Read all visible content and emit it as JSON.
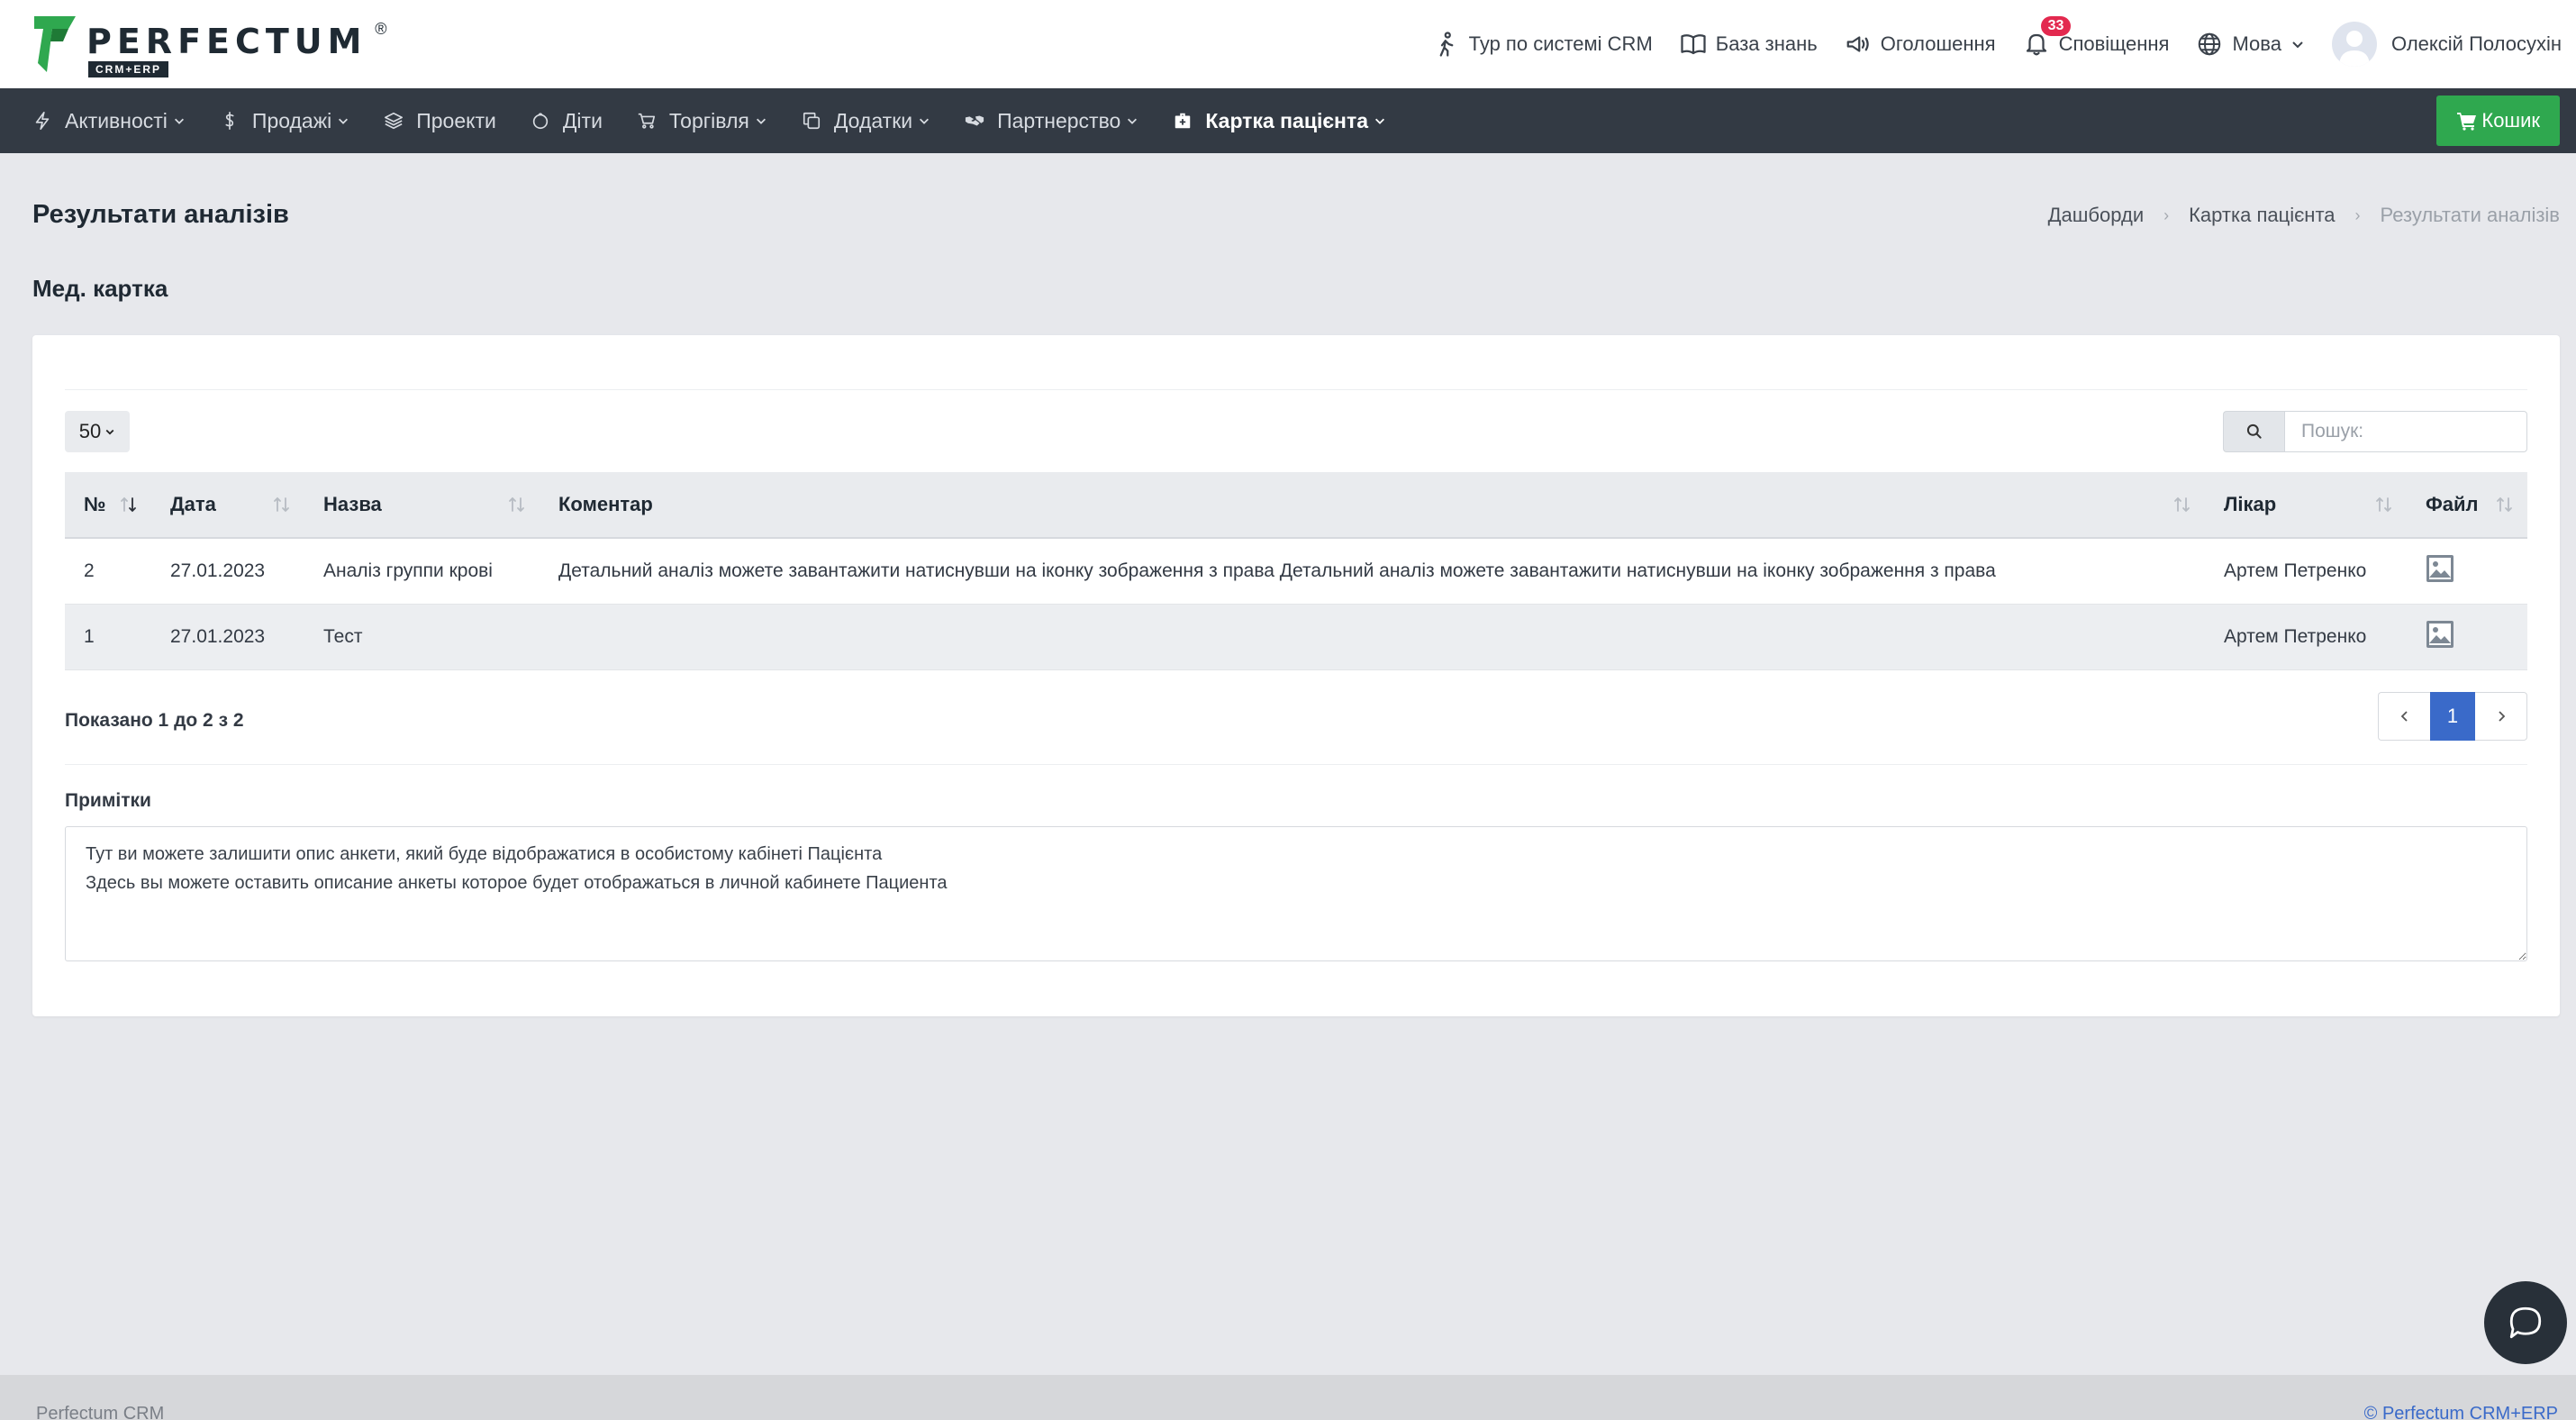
{
  "brand": {
    "name": "PERFECTUM",
    "sub": "CRM+ERP",
    "reg": "®"
  },
  "topnav": {
    "tour": "Тур по системі CRM",
    "knowledge": "База знань",
    "announcements": "Оголошення",
    "notifications": "Сповіщення",
    "notifications_count": "33",
    "language": "Мова",
    "user": "Олексій Полосухін"
  },
  "nav": {
    "items": [
      {
        "label": "Активності",
        "icon": "activity-icon"
      },
      {
        "label": "Продажі",
        "icon": "dollar-icon"
      },
      {
        "label": "Проекти",
        "icon": "layers-icon"
      },
      {
        "label": "Діти",
        "icon": "baby-icon"
      },
      {
        "label": "Торгівля",
        "icon": "cart-icon"
      },
      {
        "label": "Додатки",
        "icon": "copy-icon"
      },
      {
        "label": "Партнерство",
        "icon": "handshake-icon"
      },
      {
        "label": "Картка пацієнта",
        "icon": "medkit-icon"
      }
    ],
    "cart": "Кошик"
  },
  "page": {
    "title": "Результати аналізів",
    "breadcrumb": [
      "Дашборди",
      "Картка пацієнта",
      "Результати аналізів"
    ],
    "section": "Мед. картка"
  },
  "table": {
    "length": "50",
    "search_placeholder": "Пошук:",
    "columns": [
      "№",
      "Дата",
      "Назва",
      "Коментар",
      "Лікар",
      "Файл"
    ],
    "rows": [
      {
        "no": "2",
        "date": "27.01.2023",
        "name": "Аналіз группи крові",
        "comment": "Детальний аналіз можете завантажити натиснувши на іконку зображення з права Детальний аналіз можете завантажити натиснувши на іконку зображення з права",
        "doctor": "Артем Петренко"
      },
      {
        "no": "1",
        "date": "27.01.2023",
        "name": "Тест",
        "comment": "",
        "doctor": "Артем Петренко"
      }
    ],
    "info": "Показано 1 до 2 з 2",
    "current_page": "1"
  },
  "notes": {
    "label": "Примітки",
    "text": "Тут ви можете залишити опис анкети, який буде відображатися в особистому кабінеті Пацієнта\nЗдесь вы можете оставить описание анкеты которое будет отображаться в личной кабинете Пациента"
  },
  "footer": {
    "left": "Perfectum CRM",
    "right": "© Perfectum CRM+ERP"
  },
  "colors": {
    "navbar": "#333a44",
    "cart_button": "#2fa84f",
    "active_page": "#3a6ac9",
    "badge": "#e3294f"
  }
}
